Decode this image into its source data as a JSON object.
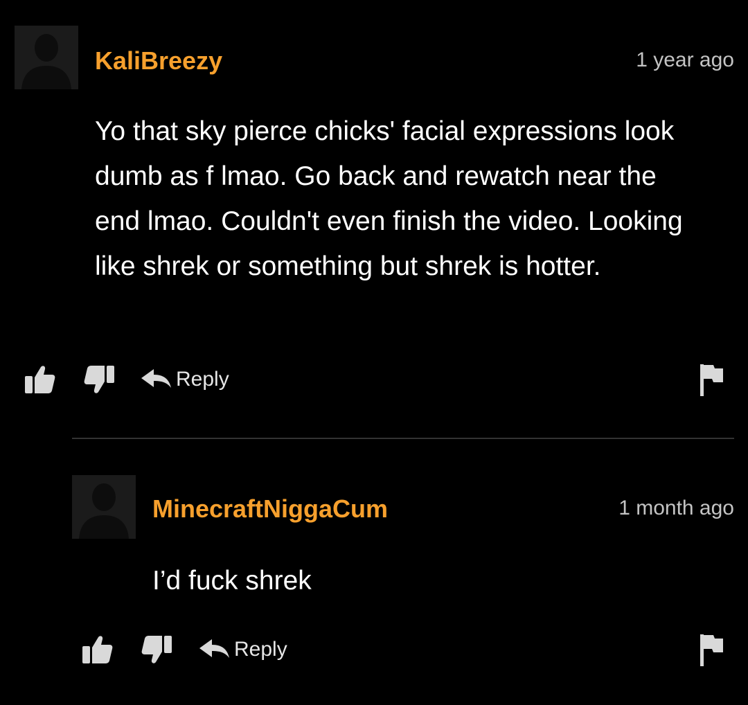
{
  "comments": [
    {
      "username": "KaliBreezy",
      "timestamp": "1 year ago",
      "text": "Yo that sky pierce chicks' facial expressions look dumb as f lmao. Go back and rewatch near the end lmao. Couldn't even finish the video. Looking like shrek or something but shrek is hotter.",
      "reply_label": "Reply"
    },
    {
      "username": "MinecraftNiggaCum",
      "timestamp": "1 month ago",
      "text": "I’d fuck shrek",
      "reply_label": "Reply"
    }
  ],
  "icons": {
    "avatar": "default-avatar-silhouette",
    "like": "thumbs-up-icon",
    "dislike": "thumbs-down-icon",
    "reply": "reply-arrow-icon",
    "flag": "flag-icon"
  },
  "colors": {
    "background": "#000000",
    "username": "#f7a02d",
    "text": "#ffffff",
    "timestamp": "#c4c4c4",
    "icon": "#d9d9d9"
  }
}
